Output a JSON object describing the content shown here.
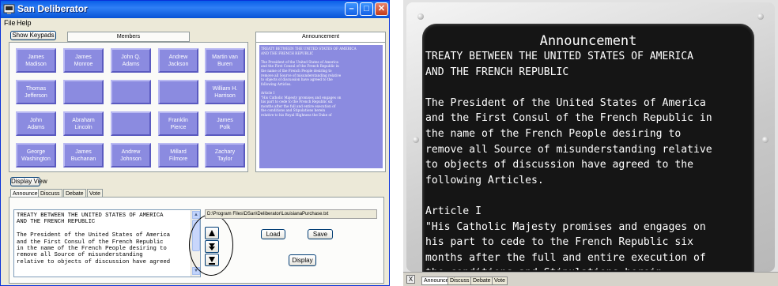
{
  "window": {
    "title": "San Deliberator",
    "menu": [
      "File",
      "Help"
    ],
    "min_glyph": "–",
    "max_glyph": "□",
    "close_glyph": "✕"
  },
  "show_keypads_label": "Show Keypads",
  "members_tab": "Members",
  "announcement_tab": "Announcement",
  "members": [
    "James\nMadison",
    "James\nMonroe",
    "John Q.\nAdams",
    "Andrew\nJackson",
    "Martin van\nBuren",
    "Thomas\nJefferson",
    "",
    "",
    "",
    "William H.\nHarrison",
    "John\nAdams",
    "Abraham\nLincoln",
    "",
    "Franklin\nPierce",
    "James\nPolk",
    "George\nWashington",
    "James\nBuchanan",
    "Andrew\nJohnson",
    "Millard\nFilmore",
    "Zachary\nTaylor"
  ],
  "announcement_preview": "TREATY BETWEEN THE UNITED STATES OF AMERICA\nAND THE FRENCH REPUBLIC\n\nThe President of the United States of America\nand the First Consul of the French Republic in\nthe name of the French People desiring to\nremove all Source of misunderstanding relative\nto objects of discussion have agreed to the\nfollowing Articles.\n\nArticle I\n\"His Catholic Majesty promises and engages on\nhis part to cede to the French Republic six\nmonths after the full and entire execution of\nthe conditions and Stipulations herein\nrelative to his Royal Highness the Duke of",
  "display_view_label": "Display View",
  "tabs": [
    "Announce",
    "Discuss",
    "Debate",
    "Vote"
  ],
  "editor_text": "TREATY BETWEEN THE UNITED STATES OF AMERICA\nAND THE FRENCH REPUBLIC\n\nThe President of the United States of America\nand the First Consul of the French Republic\nin the name of the French People desiring to\nremove all Source of misunderstanding\nrelative to objects of discussion have agreed",
  "file_path": "D:\\Program Files\\DSan\\Deliberator\\LouisianaPurchase.txt",
  "load_label": "Load",
  "save_label": "Save",
  "display_label": "Display",
  "screen": {
    "title": "Announcement",
    "text": "TREATY BETWEEN THE UNITED STATES OF AMERICA\nAND THE FRENCH REPUBLIC\n\nThe President of the United States of America\nand the First Consul of the French Republic in\nthe name of the French People desiring to\nremove all Source of misunderstanding relative\nto objects of discussion have agreed to the\nfollowing Articles.\n\nArticle I\n\"His Catholic Majesty promises and engages on\nhis part to cede to the French Republic six\nmonths after the full and entire execution of\nthe conditions and Stipulations herein\nrelative to his Royal Highness the Duke of",
    "close_glyph": "X",
    "tabs": [
      "Announce",
      "Discuss",
      "Debate",
      "Vote"
    ]
  },
  "icons": [
    "app-icon",
    "minimize-icon",
    "maximize-icon",
    "close-icon",
    "scroll-up-icon",
    "scroll-down-icon",
    "arrow-up-icon",
    "arrow-down-icon",
    "arrow-end-icon"
  ]
}
